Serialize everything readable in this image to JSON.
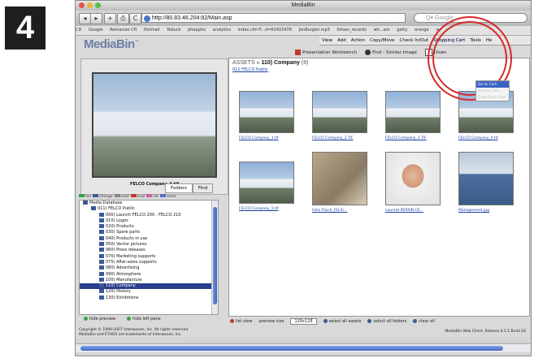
{
  "step_number": "4",
  "window": {
    "title": "MediaBin"
  },
  "toolbar": {
    "back": "◂",
    "forward": "▸",
    "add": "+",
    "print": "⎙",
    "reload": "C",
    "url": "http://80.83.46.204:82/Main.asp",
    "search_placeholder": "Q▾ Google"
  },
  "bookmarks": [
    "CD",
    "Google",
    "Remaxize CH",
    "Hotmail",
    "Yebuck",
    "pheppho",
    "analytics",
    "index.cfm?f...d=63415478",
    "JonBurgler.mp3",
    "fotoes_records",
    "wh...am",
    "getty",
    "orange",
    "≫"
  ],
  "app": {
    "logo": "MediaBin",
    "logo_tm": "™",
    "menu": [
      "View",
      "Add",
      "Action",
      "Copy/Move",
      "Check In/Out",
      "Shopping Cart",
      "Tools",
      "He"
    ],
    "cart_dropdown": [
      "Go to Cart",
      "Add to Cart",
      "Drop From Cart"
    ],
    "workbench": {
      "presentation": "Presentation Workbench",
      "find_similar": "Find - Similar Image",
      "download": "Down"
    },
    "preview_caption": "FELCO Company_4.tif",
    "folder_tabs": [
      "Folders",
      "Find"
    ],
    "legend": [
      "full",
      "change",
      "read",
      "mail",
      "list",
      "more"
    ],
    "tree": [
      {
        "label": "Media Database",
        "indent": 0
      },
      {
        "label": "011) FELCO Public",
        "indent": 1
      },
      {
        "label": "000) Launch FELCO 200 - FELCO 210",
        "indent": 2
      },
      {
        "label": "010) Logos",
        "indent": 2
      },
      {
        "label": "020) Products",
        "indent": 2
      },
      {
        "label": "030) Spare parts",
        "indent": 2
      },
      {
        "label": "040) Products in use",
        "indent": 2
      },
      {
        "label": "050) Vector pictures",
        "indent": 2
      },
      {
        "label": "060) Press releases",
        "indent": 2
      },
      {
        "label": "070) Marketing supports",
        "indent": 2
      },
      {
        "label": "075) After-sales supports",
        "indent": 2
      },
      {
        "label": "080) Advertising",
        "indent": 2
      },
      {
        "label": "090) Atmosphere",
        "indent": 2
      },
      {
        "label": "100) Manufacture",
        "indent": 2
      },
      {
        "label": "110) Company",
        "indent": 2,
        "selected": true
      },
      {
        "label": "120) History",
        "indent": 2
      },
      {
        "label": "130) Exhibitions",
        "indent": 2
      }
    ],
    "left_footer": {
      "hide_preview": "hide preview",
      "hide_left": "hide left pane"
    },
    "assets": {
      "header_prefix": "ASSETS",
      "header_in": "in",
      "header_folder": "110) Company",
      "header_count": "(8)",
      "parent_link": "011 FELCO Public",
      "items": [
        {
          "caption": "FELCO Company_1.tif",
          "kind": "building"
        },
        {
          "caption": "FELCO Company_2.TIF",
          "kind": "building"
        },
        {
          "caption": "FELCO Company_3.TIF",
          "kind": "building"
        },
        {
          "caption": "FELCO Company_4.tif",
          "kind": "building"
        },
        {
          "caption": "FELCO Company_5.tif",
          "kind": "building"
        },
        {
          "caption": "Felix Flisch_FELIC...",
          "kind": "statue"
        },
        {
          "caption": "Laurent PERRIN CE...",
          "kind": "face"
        },
        {
          "caption": "Management.jpg",
          "kind": "team"
        }
      ]
    },
    "bottom_bar": {
      "list_view": "list view",
      "preview_size": "preview size",
      "size_value": "128x128",
      "select_assets": "select all assets",
      "select_folders": "select all folders",
      "clear_all": "clear all"
    },
    "copyright_1": "Copyright © 1999-2007 Interwoven, Inc. All rights reserved.",
    "copyright_2": "MediaBin and ETHOS are trademarks of Interwoven, Inc.",
    "version": "MediaBin Web Client, Release 4.5.1 Build 16"
  },
  "colors": {
    "accent": "#3f66c4",
    "highlight_circle": "#d62828",
    "selection": "#2a3e8f"
  }
}
